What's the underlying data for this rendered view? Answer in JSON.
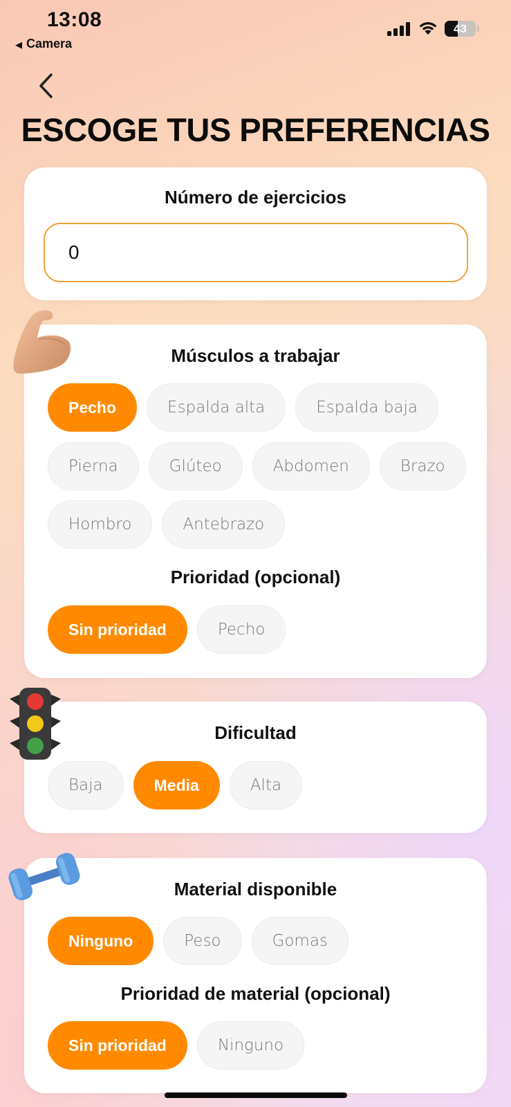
{
  "status_bar": {
    "time": "13:08",
    "back_app": "Camera",
    "battery_percent": "43",
    "battery_level": 0.43
  },
  "page": {
    "title": "ESCOGE TUS PREFERENCIAS"
  },
  "exercise_count": {
    "title": "Número de ejercicios",
    "value": "0"
  },
  "muscles": {
    "title": "Músculos a trabajar",
    "icon": "flexed-biceps-icon",
    "options": [
      "Pecho",
      "Espalda alta",
      "Espalda baja",
      "Pierna",
      "Glúteo",
      "Abdomen",
      "Brazo",
      "Hombro",
      "Antebrazo"
    ],
    "selected": "Pecho",
    "priority_title": "Prioridad (opcional)",
    "priority_options": [
      "Sin prioridad",
      "Pecho"
    ],
    "priority_selected": "Sin prioridad"
  },
  "difficulty": {
    "title": "Dificultad",
    "icon": "traffic-light-icon",
    "options": [
      "Baja",
      "Media",
      "Alta"
    ],
    "selected": "Media"
  },
  "equipment": {
    "title": "Material disponible",
    "icon": "dumbbell-icon",
    "options": [
      "Ninguno",
      "Peso",
      "Gomas"
    ],
    "selected": "Ninguno",
    "priority_title": "Prioridad de material (opcional)",
    "priority_options": [
      "Sin prioridad",
      "Ninguno"
    ],
    "priority_selected": "Sin prioridad"
  },
  "colors": {
    "accent": "#ff8a00",
    "chip_bg": "#f5f5f5",
    "input_border": "#f0a23c"
  }
}
